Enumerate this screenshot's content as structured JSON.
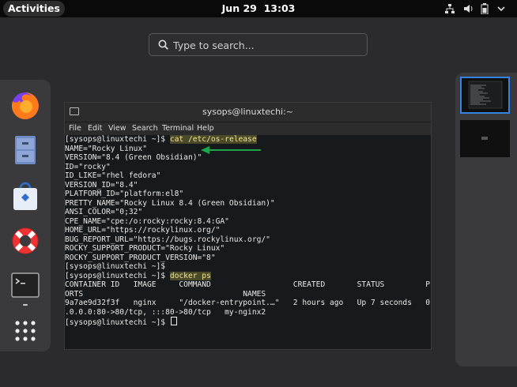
{
  "topbar": {
    "activities": "Activities",
    "date": "Jun 29",
    "time": "13:03"
  },
  "search": {
    "placeholder": "Type to search..."
  },
  "dash": {
    "items": [
      {
        "name": "firefox-icon"
      },
      {
        "name": "file-cabinet-icon"
      },
      {
        "name": "software-store-icon"
      },
      {
        "name": "help-lifebuoy-icon"
      },
      {
        "name": "terminal-icon"
      },
      {
        "name": "app-grid-icon"
      }
    ]
  },
  "terminal": {
    "title": "sysops@linuxtechi:~",
    "menu": [
      "File",
      "Edit",
      "View",
      "Search",
      "Terminal",
      "Help"
    ],
    "prompt": "[sysops@linuxtechi ~]$ ",
    "cmd1": "cat /etc/os-release",
    "cmd2": "docker ps",
    "output": [
      "NAME=\"Rocky Linux\"",
      "VERSION=\"8.4 (Green Obsidian)\"",
      "ID=\"rocky\"",
      "ID_LIKE=\"rhel fedora\"",
      "VERSION_ID=\"8.4\"",
      "PLATFORM_ID=\"platform:el8\"",
      "PRETTY_NAME=\"Rocky Linux 8.4 (Green Obsidian)\"",
      "ANSI_COLOR=\"0;32\"",
      "CPE_NAME=\"cpe:/o:rocky:rocky:8.4:GA\"",
      "HOME_URL=\"https://rockylinux.org/\"",
      "BUG_REPORT_URL=\"https://bugs.rockylinux.org/\"",
      "ROCKY_SUPPORT_PRODUCT=\"Rocky Linux\"",
      "ROCKY_SUPPORT_PRODUCT_VERSION=\"8\""
    ],
    "prompt_empty": "[sysops@linuxtechi ~]$",
    "docker_output": [
      "CONTAINER ID   IMAGE     COMMAND                  CREATED       STATUS         P",
      "ORTS                                   NAMES",
      "9a7ae9d32f3f   nginx     \"/docker-entrypoint.…\"   2 hours ago   Up 7 seconds   0",
      ".0.0.0:80->80/tcp, :::80->80/tcp   my-nginx2"
    ]
  },
  "colors": {
    "arrow": "#1ea64a",
    "highlight_text": "#f0e68c",
    "accent": "#3584e4"
  }
}
